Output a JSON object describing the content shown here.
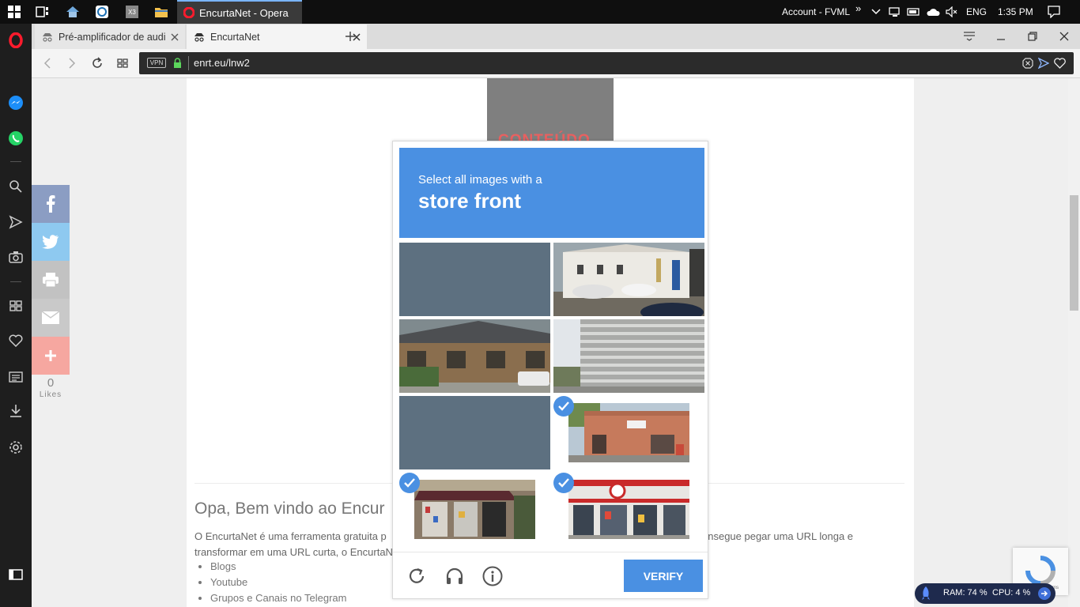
{
  "taskbar": {
    "active_app_title": "EncurtaNet - Opera",
    "account_label": "Account - FVML",
    "language": "ENG",
    "time": "1:35 PM",
    "overflow_glyph": "»",
    "pinned_label": "X3"
  },
  "tabs": [
    {
      "title": "Pré-amplificador de audio",
      "active": false
    },
    {
      "title": "EncurtaNet",
      "active": true
    }
  ],
  "address_bar": {
    "vpn_label": "VPN",
    "url": "enrt.eu/lnw2"
  },
  "share": {
    "buttons": [
      {
        "name": "facebook",
        "color": "#8b9dc3"
      },
      {
        "name": "twitter",
        "color": "#8ec9f0"
      },
      {
        "name": "print",
        "color": "#c2c2c2"
      },
      {
        "name": "email",
        "color": "#c9c9c9"
      },
      {
        "name": "more",
        "color": "#f6a7a0"
      }
    ],
    "likes_count": "0",
    "likes_label": "Likes"
  },
  "article": {
    "ad_text": "CONTEÚDO",
    "heading": "Opa, Bem vindo ao Encur",
    "para_line1_left": " O EncurtaNet é uma ferramenta gratuita p",
    "para_line1_right": "onsegue pegar uma URL longa e",
    "para_line2_left": "transformar em uma URL curta, o EncurtaN",
    "list_items": [
      "Blogs",
      "Youtube",
      "Grupos e Canais no Telegram"
    ]
  },
  "captcha": {
    "prompt": "Select all images with a",
    "target": "store front",
    "verify_label": "VERIFY",
    "accent": "#4a90e2",
    "cells": [
      {
        "desc": "blank",
        "selected": false
      },
      {
        "desc": "white-building",
        "selected": false
      },
      {
        "desc": "wood-house",
        "selected": false
      },
      {
        "desc": "office-building",
        "selected": false
      },
      {
        "desc": "blank",
        "selected": false
      },
      {
        "desc": "brick-store",
        "selected": true
      },
      {
        "desc": "storefront-awning",
        "selected": true
      },
      {
        "desc": "circle-k-store",
        "selected": true
      }
    ]
  },
  "recaptcha": {
    "terms": "rms"
  },
  "sysmon": {
    "ram_label": "RAM: 74 %",
    "cpu_label": "CPU: 4 %"
  }
}
